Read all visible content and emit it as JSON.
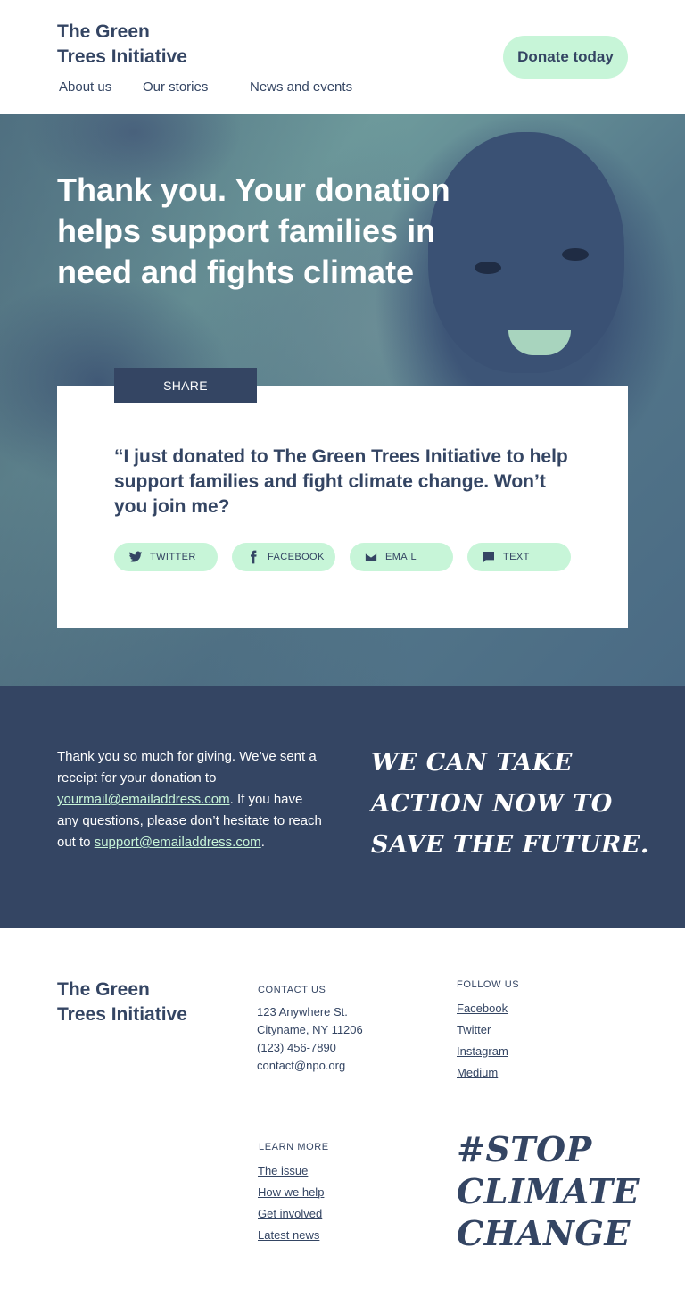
{
  "header": {
    "brand_line1": "The Green",
    "brand_line2": "Trees Initiative",
    "nav": [
      "About us",
      "Our stories",
      "News and events"
    ],
    "donate_label": "Donate today"
  },
  "hero": {
    "title": "Thank you. Your donation helps support families in need and fights climate"
  },
  "share": {
    "tab_label": "SHARE",
    "quote": "“I just donated to The Green Trees Initiative to help support families and fight climate change. Won’t you join me?",
    "buttons": [
      {
        "label": "TWITTER",
        "icon": "twitter-icon"
      },
      {
        "label": "FACEBOOK",
        "icon": "facebook-icon"
      },
      {
        "label": "EMAIL",
        "icon": "email-icon"
      },
      {
        "label": "TEXT",
        "icon": "chat-icon"
      }
    ]
  },
  "thanks": {
    "text_before": "Thank you so much for giving. We’ve sent a receipt for your donation to ",
    "receipt_email": "yourmail@emailaddress.com",
    "text_middle": ". If you have any questions, please don’t hesitate to reach out to ",
    "support_email": "support@emailaddress.com",
    "text_after": ".",
    "slogan_line1": "We can take",
    "slogan_line2": "action now to",
    "slogan_line3": "save the future."
  },
  "footer": {
    "brand_line1": "The Green",
    "brand_line2": "Trees Initiative",
    "contact_heading": "CONTACT US",
    "contact_lines": [
      "123 Anywhere St.",
      "Cityname, NY 11206",
      "(123) 456-7890",
      "contact@npo.org"
    ],
    "follow_heading": "FOLLOW US",
    "follow_links": [
      "Facebook",
      "Twitter",
      "Instagram",
      "Medium"
    ],
    "learn_heading": "LEARN MORE",
    "learn_links": [
      "The issue",
      "How we help",
      "Get involved",
      "Latest news"
    ],
    "hashtag_line1": "#Stop",
    "hashtag_line2": "climate",
    "hashtag_line3": "change"
  },
  "colors": {
    "navy": "#344563",
    "mint": "#c7f5d8",
    "white": "#ffffff"
  }
}
